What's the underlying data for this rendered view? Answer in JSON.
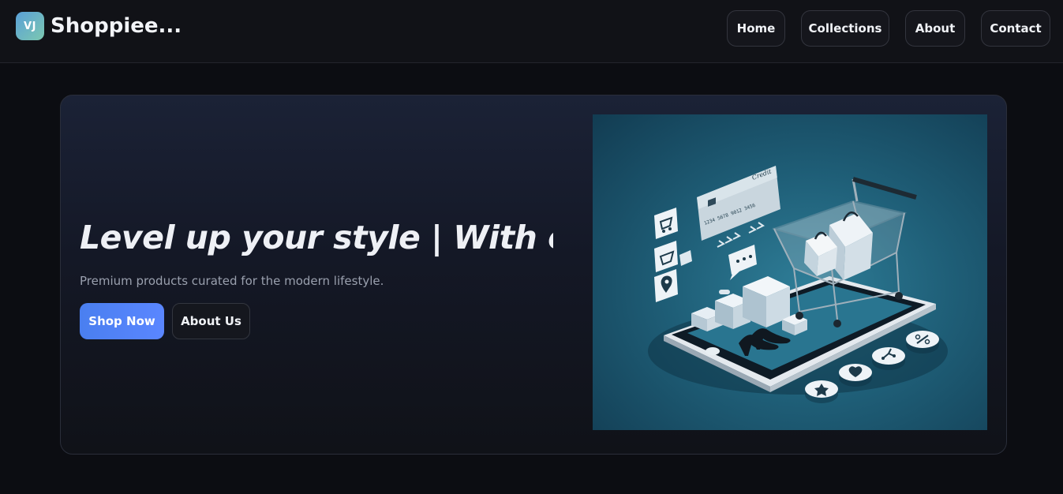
{
  "brand": {
    "logo_text": "VJ",
    "name": "Shoppiee..."
  },
  "nav": {
    "home": "Home",
    "collections": "Collections",
    "about": "About",
    "contact": "Contact"
  },
  "hero": {
    "title": "Level up your style | With o",
    "subtitle": "Premium products curated for the modern lifestyle.",
    "primary_button": "Shop Now",
    "secondary_button": "About Us"
  },
  "illustration": {
    "card_brand": "Credit",
    "card_number": "1234 5678 9012 3456",
    "icons": [
      "cart-icon",
      "basket-icon",
      "location-pin-icon",
      "chat-icon",
      "star-icon",
      "heart-icon",
      "share-icon",
      "percent-icon"
    ]
  },
  "colors": {
    "background": "#0c0d12",
    "navbar": "#111217",
    "accent": "#4a7ff0",
    "illustration_bg": "#1f5f78"
  }
}
